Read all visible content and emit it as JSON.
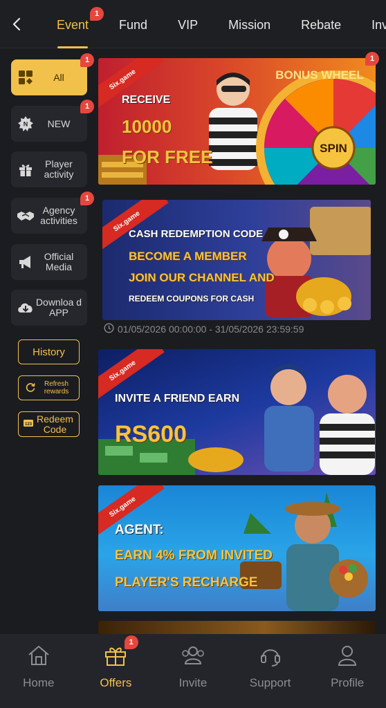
{
  "header": {
    "tabs": [
      {
        "label": "Event",
        "active": true,
        "badge": "1"
      },
      {
        "label": "Fund"
      },
      {
        "label": "VIP"
      },
      {
        "label": "Mission"
      },
      {
        "label": "Rebate"
      },
      {
        "label": "Inv"
      }
    ]
  },
  "sidebar": {
    "items": [
      {
        "label": "All",
        "active": true,
        "badge": "1",
        "icon": "grid-icon"
      },
      {
        "label": "NEW",
        "badge": "1",
        "icon": "new-burst-icon"
      },
      {
        "label": "Player activity",
        "icon": "gift-icon"
      },
      {
        "label": "Agency activities",
        "badge": "1",
        "icon": "handshake-icon"
      },
      {
        "label": "Official Media",
        "icon": "megaphone-icon"
      },
      {
        "label": "Downloa d APP",
        "icon": "cloud-download-icon"
      }
    ],
    "history_label": "History",
    "refresh_label": "Refresh rewards",
    "redeem_label": "Redeem Code"
  },
  "banners": {
    "first": {
      "brand": "Six.game",
      "line1": "RECEIVE",
      "line2": "10000",
      "line3": "FOR FREE",
      "wheel_top": "BONUS WHEEL",
      "wheel_center": "SPIN",
      "badge": "1"
    },
    "second": {
      "brand": "Six.game",
      "line1": "CASH REDEMPTION CODE",
      "line2": "BECOME A MEMBER",
      "line3": "JOIN OUR CHANNEL AND",
      "line4": "REDEEM COUPONS FOR CASH",
      "date_range": "01/05/2026 00:00:00 - 31/05/2026 23:59:59"
    },
    "third": {
      "brand": "Six.game",
      "line1": "INVITE A FRIEND EARN",
      "line2": "RS600"
    },
    "fourth": {
      "brand": "Six.game",
      "line1": "AGENT:",
      "line2": "EARN 4% FROM INVITED",
      "line3": "PLAYER'S RECHARGE"
    }
  },
  "bottom_nav": {
    "items": [
      {
        "label": "Home"
      },
      {
        "label": "Offers",
        "active": true,
        "badge": "1"
      },
      {
        "label": "Invite"
      },
      {
        "label": "Support"
      },
      {
        "label": "Profile"
      }
    ]
  },
  "colors": {
    "accent": "#f2c14b",
    "badge": "#e5473f",
    "background": "#1b1c20"
  }
}
